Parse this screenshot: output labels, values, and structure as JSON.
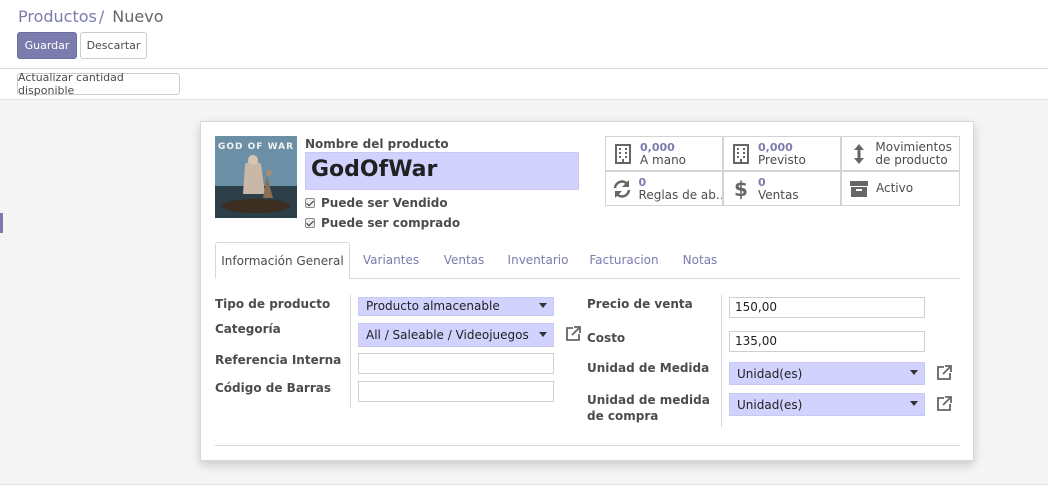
{
  "breadcrumb": {
    "parent": "Productos",
    "separator": "/",
    "current": "Nuevo"
  },
  "buttons": {
    "save": "Guardar",
    "discard": "Descartar",
    "update_qty": "Actualizar cantidad disponible"
  },
  "product": {
    "name_label": "Nombre del producto",
    "name": "GodOfWar",
    "image_title": "GOD OF WAR",
    "can_be_sold": "Puede ser Vendido",
    "can_be_purchased": "Puede ser comprado"
  },
  "stats": [
    {
      "value": "0,000",
      "label": "A mano",
      "icon": "building-icon"
    },
    {
      "value": "0,000",
      "label": "Previsto",
      "icon": "building-icon"
    },
    {
      "value": "",
      "label": "Movimientos de producto",
      "icon": "up-down-arrow-icon"
    },
    {
      "value": "0",
      "label": "Reglas de ab…",
      "icon": "refresh-icon"
    },
    {
      "value": "0",
      "label": "Ventas",
      "icon": "dollar-icon"
    },
    {
      "value": "",
      "label": "Activo",
      "icon": "archive-icon"
    }
  ],
  "tabs": [
    "Información General",
    "Variantes",
    "Ventas",
    "Inventario",
    "Facturacion",
    "Notas"
  ],
  "general": {
    "product_type_label": "Tipo de producto",
    "product_type": "Producto almacenable",
    "category_label": "Categoría",
    "category": "All / Saleable / Videojuegos",
    "internal_ref_label": "Referencia Interna",
    "internal_ref": "",
    "barcode_label": "Código de Barras",
    "barcode": "",
    "sale_price_label": "Precio de venta",
    "sale_price": "150,00",
    "cost_label": "Costo",
    "cost": "135,00",
    "uom_label": "Unidad de Medida",
    "uom": "Unidad(es)",
    "uom_po_label": "Unidad de medida de compra",
    "uom_po": "Unidad(es)"
  },
  "colors": {
    "accent": "#7c7bad",
    "required_bg": "#d2d2ff"
  }
}
